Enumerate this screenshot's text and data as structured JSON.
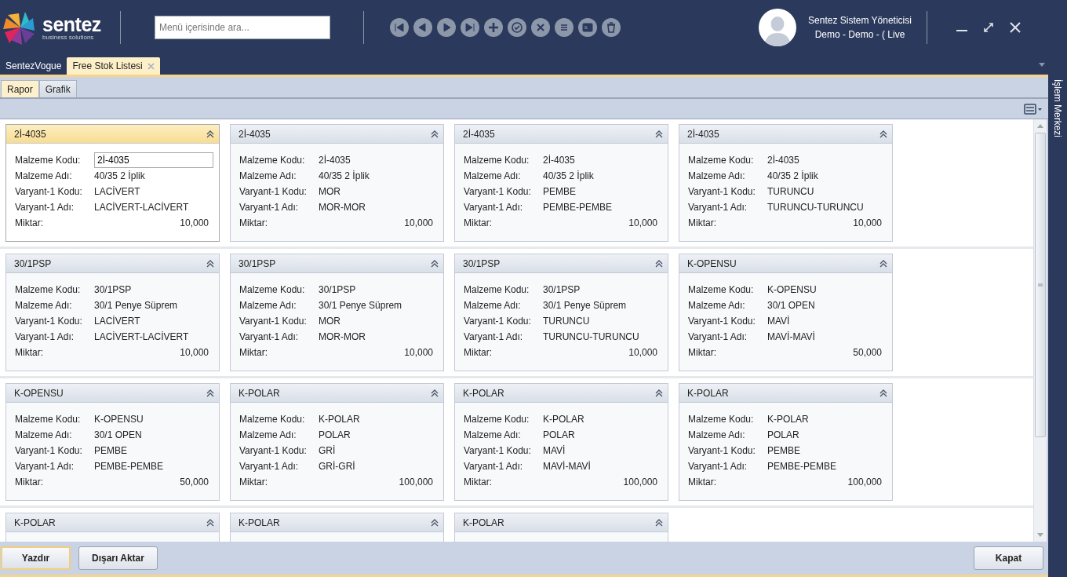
{
  "header": {
    "logo": {
      "name": "sentez",
      "tagline": "business solutions"
    },
    "search": {
      "placeholder": "Menü içerisinde ara..."
    },
    "user": {
      "name": "Sentez Sistem Yöneticisi",
      "company": "Demo - Demo - ( Live"
    }
  },
  "doc_tabs": [
    {
      "label": "SentezVogue",
      "selected": false,
      "closable": false
    },
    {
      "label": "Free Stok Listesi",
      "selected": true,
      "closable": true
    }
  ],
  "sub_tabs": [
    {
      "label": "Rapor",
      "selected": true
    },
    {
      "label": "Grafik",
      "selected": false
    }
  ],
  "side_panel": {
    "title": "İşlem Merkezi"
  },
  "cards": [
    {
      "title": "2İ-4035",
      "selected": true,
      "fields": [
        {
          "label": "Malzeme Kodu:",
          "value": "2İ-4035"
        },
        {
          "label": "Malzeme Adı:",
          "value": "40/35 2 İplik"
        },
        {
          "label": "Varyant-1 Kodu:",
          "value": "LACİVERT"
        },
        {
          "label": "Varyant-1 Adı:",
          "value": "LACİVERT-LACİVERT"
        }
      ],
      "quantity": {
        "label": "Miktar:",
        "value": "10,000"
      }
    },
    {
      "title": "2İ-4035",
      "selected": false,
      "fields": [
        {
          "label": "Malzeme Kodu:",
          "value": "2İ-4035"
        },
        {
          "label": "Malzeme Adı:",
          "value": "40/35 2 İplik"
        },
        {
          "label": "Varyant-1 Kodu:",
          "value": "MOR"
        },
        {
          "label": "Varyant-1 Adı:",
          "value": "MOR-MOR"
        }
      ],
      "quantity": {
        "label": "Miktar:",
        "value": "10,000"
      }
    },
    {
      "title": "2İ-4035",
      "selected": false,
      "fields": [
        {
          "label": "Malzeme Kodu:",
          "value": "2İ-4035"
        },
        {
          "label": "Malzeme Adı:",
          "value": "40/35 2 İplik"
        },
        {
          "label": "Varyant-1 Kodu:",
          "value": "PEMBE"
        },
        {
          "label": "Varyant-1 Adı:",
          "value": "PEMBE-PEMBE"
        }
      ],
      "quantity": {
        "label": "Miktar:",
        "value": "10,000"
      }
    },
    {
      "title": "2İ-4035",
      "selected": false,
      "fields": [
        {
          "label": "Malzeme Kodu:",
          "value": "2İ-4035"
        },
        {
          "label": "Malzeme Adı:",
          "value": "40/35 2 İplik"
        },
        {
          "label": "Varyant-1 Kodu:",
          "value": "TURUNCU"
        },
        {
          "label": "Varyant-1 Adı:",
          "value": "TURUNCU-TURUNCU"
        }
      ],
      "quantity": {
        "label": "Miktar:",
        "value": "10,000"
      }
    },
    {
      "title": "30/1PSP",
      "selected": false,
      "fields": [
        {
          "label": "Malzeme Kodu:",
          "value": "30/1PSP"
        },
        {
          "label": "Malzeme Adı:",
          "value": "30/1 Penye Süprem"
        },
        {
          "label": "Varyant-1 Kodu:",
          "value": "LACİVERT"
        },
        {
          "label": "Varyant-1 Adı:",
          "value": "LACİVERT-LACİVERT"
        }
      ],
      "quantity": {
        "label": "Miktar:",
        "value": "10,000"
      }
    },
    {
      "title": "30/1PSP",
      "selected": false,
      "fields": [
        {
          "label": "Malzeme Kodu:",
          "value": "30/1PSP"
        },
        {
          "label": "Malzeme Adı:",
          "value": "30/1 Penye Süprem"
        },
        {
          "label": "Varyant-1 Kodu:",
          "value": "MOR"
        },
        {
          "label": "Varyant-1 Adı:",
          "value": "MOR-MOR"
        }
      ],
      "quantity": {
        "label": "Miktar:",
        "value": "10,000"
      }
    },
    {
      "title": "30/1PSP",
      "selected": false,
      "fields": [
        {
          "label": "Malzeme Kodu:",
          "value": "30/1PSP"
        },
        {
          "label": "Malzeme Adı:",
          "value": "30/1 Penye Süprem"
        },
        {
          "label": "Varyant-1 Kodu:",
          "value": "TURUNCU"
        },
        {
          "label": "Varyant-1 Adı:",
          "value": "TURUNCU-TURUNCU"
        }
      ],
      "quantity": {
        "label": "Miktar:",
        "value": "10,000"
      }
    },
    {
      "title": "K-OPENSU",
      "selected": false,
      "fields": [
        {
          "label": "Malzeme Kodu:",
          "value": "K-OPENSU"
        },
        {
          "label": "Malzeme Adı:",
          "value": "30/1 OPEN"
        },
        {
          "label": "Varyant-1 Kodu:",
          "value": "MAVİ"
        },
        {
          "label": "Varyant-1 Adı:",
          "value": "MAVİ-MAVİ"
        }
      ],
      "quantity": {
        "label": "Miktar:",
        "value": "50,000"
      }
    },
    {
      "title": "K-OPENSU",
      "selected": false,
      "fields": [
        {
          "label": "Malzeme Kodu:",
          "value": "K-OPENSU"
        },
        {
          "label": "Malzeme Adı:",
          "value": "30/1 OPEN"
        },
        {
          "label": "Varyant-1 Kodu:",
          "value": "PEMBE"
        },
        {
          "label": "Varyant-1 Adı:",
          "value": "PEMBE-PEMBE"
        }
      ],
      "quantity": {
        "label": "Miktar:",
        "value": "50,000"
      }
    },
    {
      "title": "K-POLAR",
      "selected": false,
      "fields": [
        {
          "label": "Malzeme Kodu:",
          "value": "K-POLAR"
        },
        {
          "label": "Malzeme Adı:",
          "value": "POLAR"
        },
        {
          "label": "Varyant-1 Kodu:",
          "value": "GRİ"
        },
        {
          "label": "Varyant-1 Adı:",
          "value": "GRİ-GRİ"
        }
      ],
      "quantity": {
        "label": "Miktar:",
        "value": "100,000"
      }
    },
    {
      "title": "K-POLAR",
      "selected": false,
      "fields": [
        {
          "label": "Malzeme Kodu:",
          "value": "K-POLAR"
        },
        {
          "label": "Malzeme Adı:",
          "value": "POLAR"
        },
        {
          "label": "Varyant-1 Kodu:",
          "value": "MAVİ"
        },
        {
          "label": "Varyant-1 Adı:",
          "value": "MAVİ-MAVİ"
        }
      ],
      "quantity": {
        "label": "Miktar:",
        "value": "100,000"
      }
    },
    {
      "title": "K-POLAR",
      "selected": false,
      "fields": [
        {
          "label": "Malzeme Kodu:",
          "value": "K-POLAR"
        },
        {
          "label": "Malzeme Adı:",
          "value": "POLAR"
        },
        {
          "label": "Varyant-1 Kodu:",
          "value": "PEMBE"
        },
        {
          "label": "Varyant-1 Adı:",
          "value": "PEMBE-PEMBE"
        }
      ],
      "quantity": {
        "label": "Miktar:",
        "value": "100,000"
      }
    },
    {
      "title": "K-POLAR",
      "selected": false
    },
    {
      "title": "K-POLAR",
      "selected": false
    },
    {
      "title": "K-POLAR",
      "selected": false
    }
  ],
  "buttons": [
    {
      "label": "Yazdır",
      "focused": true,
      "pinned_right": false
    },
    {
      "label": "Dışarı Aktar",
      "focused": false,
      "pinned_right": false
    },
    {
      "label": "Kapat",
      "focused": false,
      "pinned_right": true
    }
  ]
}
